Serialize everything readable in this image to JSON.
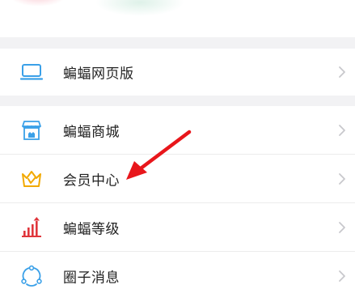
{
  "groups": [
    {
      "items": [
        {
          "label": "蝙蝠网页版",
          "icon": "laptop-icon"
        }
      ]
    },
    {
      "items": [
        {
          "label": "蝙蝠商城",
          "icon": "store-icon"
        },
        {
          "label": "会员中心",
          "icon": "crown-icon"
        },
        {
          "label": "蝙蝠等级",
          "icon": "level-chart-icon"
        },
        {
          "label": "圈子消息",
          "icon": "circle-message-icon"
        }
      ]
    }
  ],
  "colors": {
    "background": "#f2f2f4",
    "card": "#ffffff",
    "text": "#222222",
    "chevron": "#c8c8cc",
    "accent_blue": "#3aa0e8",
    "accent_gold": "#f2a900",
    "accent_red": "#e0363c",
    "annotation_arrow": "#e8161b"
  },
  "annotation": {
    "type": "red-arrow",
    "points_to": "会员中心"
  }
}
